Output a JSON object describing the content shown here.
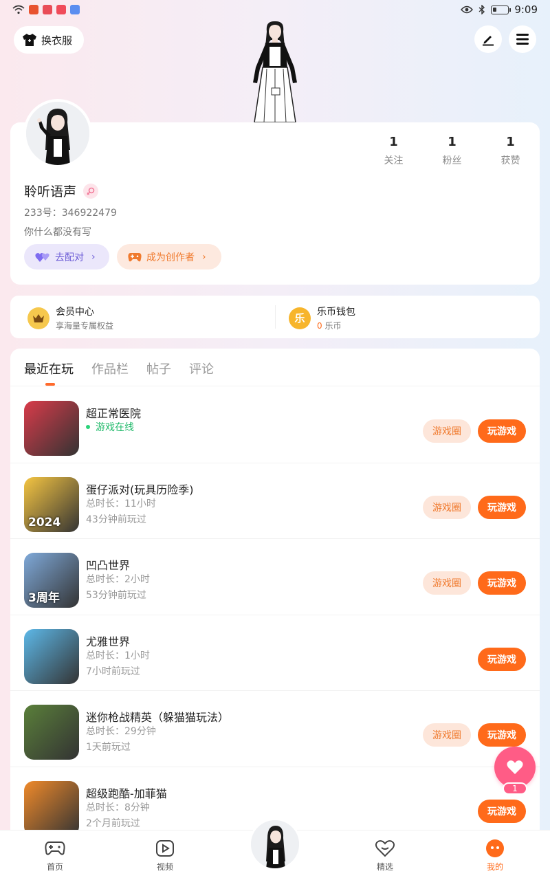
{
  "status_bar": {
    "time": "9:09"
  },
  "header": {
    "outfit_label": "换衣服"
  },
  "profile": {
    "stats": [
      {
        "value": "1",
        "label": "关注"
      },
      {
        "value": "1",
        "label": "粉丝"
      },
      {
        "value": "1",
        "label": "获赞"
      }
    ],
    "username": "聆听语声",
    "uid": "233号：346922479",
    "bio": "你什么都没有写",
    "match_label": "去配对",
    "creator_label": "成为创作者"
  },
  "member": {
    "title": "会员中心",
    "subtitle": "享海量专属权益"
  },
  "wallet": {
    "title": "乐币钱包",
    "coin_glyph": "乐",
    "amount": "0",
    "unit": " 乐币"
  },
  "tabs": [
    "最近在玩",
    "作品栏",
    "帖子",
    "评论"
  ],
  "games": [
    {
      "name": "超正常医院",
      "status": "游戏在线",
      "line2": "",
      "online": true,
      "circle": "游戏圈",
      "play": "玩游戏",
      "icon_color": "#d93b4a"
    },
    {
      "name": "蛋仔派对(玩具历险季)",
      "status": "总时长：11小时",
      "line2": "43分钟前玩过",
      "online": false,
      "circle": "游戏圈",
      "play": "玩游戏",
      "icon_color": "#f5c542",
      "icon_text": "2024"
    },
    {
      "name": "凹凸世界",
      "status": "总时长：2小时",
      "line2": "53分钟前玩过",
      "online": false,
      "circle": "游戏圈",
      "play": "玩游戏",
      "icon_color": "#7fa9d9",
      "icon_text": "3周年"
    },
    {
      "name": "尤雅世界",
      "status": "总时长：1小时",
      "line2": "7小时前玩过",
      "online": false,
      "circle": "",
      "play": "玩游戏",
      "icon_color": "#5db8e8"
    },
    {
      "name": "迷你枪战精英（躲猫猫玩法）",
      "status": "总时长：29分钟",
      "line2": "1天前玩过",
      "online": false,
      "circle": "游戏圈",
      "play": "玩游戏",
      "icon_color": "#5a7f3a"
    },
    {
      "name": "超级跑酷-加菲猫",
      "status": "总时长：8分钟",
      "line2": "2个月前玩过",
      "online": false,
      "circle": "",
      "play": "玩游戏",
      "icon_color": "#f08a2a"
    }
  ],
  "fab": {
    "count": "1"
  },
  "nav": [
    {
      "label": "首页",
      "icon": "gamepad-icon"
    },
    {
      "label": "视频",
      "icon": "play-icon"
    },
    {
      "label": "精选",
      "icon": "heart-outline-icon"
    },
    {
      "label": "我的",
      "icon": "face-icon",
      "active": true
    }
  ],
  "colors": {
    "accent": "#ff6a1a",
    "match": "#6b5bd6",
    "online": "#20b96a",
    "fab": "#ff5c86"
  }
}
